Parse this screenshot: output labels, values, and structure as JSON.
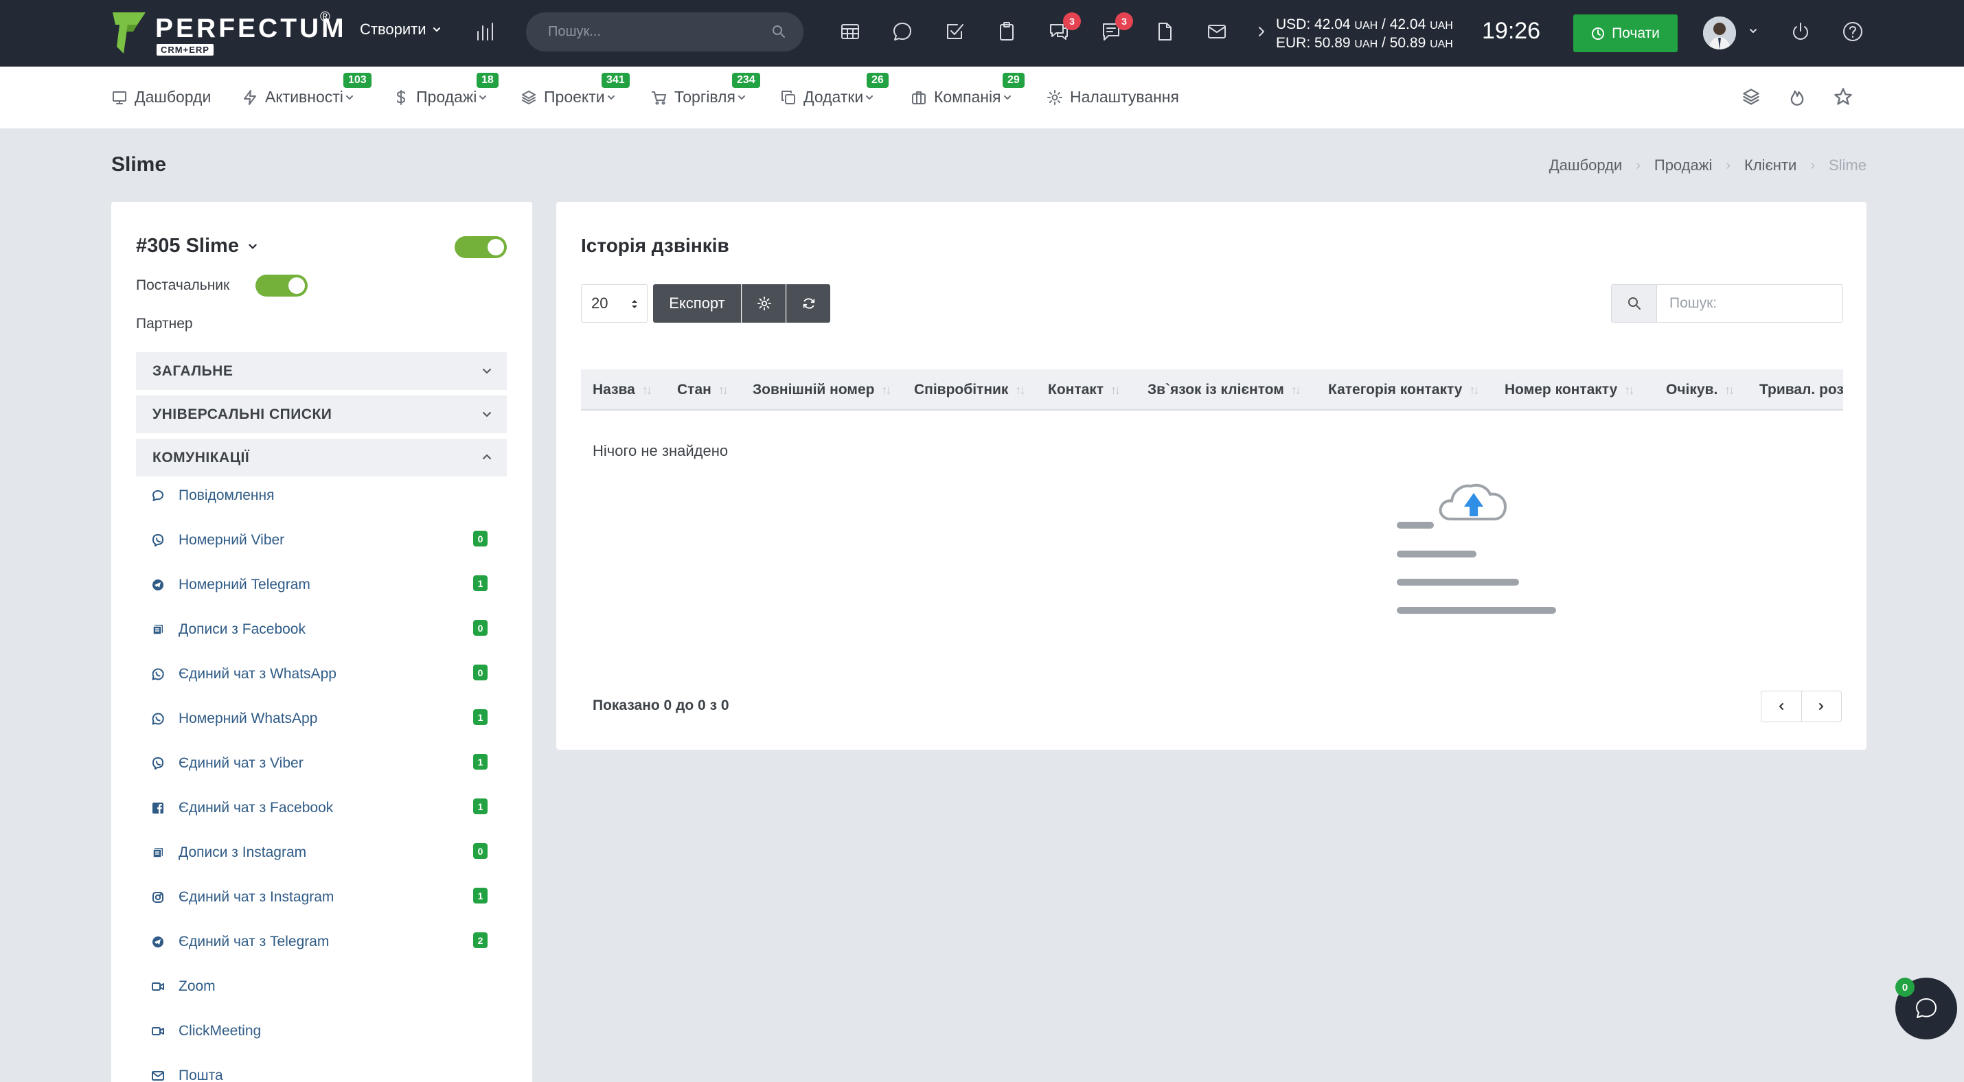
{
  "brand": {
    "name": "PERFECTUM",
    "sub": "CRM+ERP",
    "reg": "®"
  },
  "topbar": {
    "create_label": "Створити",
    "search_placeholder": "Пошук...",
    "icon_badges": {
      "chat_bubble": "3",
      "messages": "3"
    },
    "rates": {
      "usd": "USD: 42.04",
      "usd_rest": " / 42.04 ",
      "eur": "EUR: 50.89",
      "eur_rest": " / 50.89 ",
      "unit": "UAH"
    },
    "time": "19:26",
    "start_label": "Почати"
  },
  "menu": [
    {
      "label": "Дашборди",
      "icon": "monitor-icon",
      "badge": null
    },
    {
      "label": "Активності",
      "icon": "bolt-icon",
      "badge": "103"
    },
    {
      "label": "Продажі",
      "icon": "dollar-icon",
      "badge": "18"
    },
    {
      "label": "Проекти",
      "icon": "layers-icon",
      "badge": "341"
    },
    {
      "label": "Торгівля",
      "icon": "cart-icon",
      "badge": "234"
    },
    {
      "label": "Додатки",
      "icon": "copy-icon",
      "badge": "26"
    },
    {
      "label": "Компанія",
      "icon": "briefcase-icon",
      "badge": "29"
    },
    {
      "label": "Налаштування",
      "icon": "gear-icon",
      "badge": null
    }
  ],
  "page": {
    "title": "Slime",
    "breadcrumb": [
      "Дашборди",
      "Продажі",
      "Клієнти",
      "Slime"
    ]
  },
  "client": {
    "name": "#305 Slime",
    "supplier_label": "Постачальник",
    "partner_label": "Партнер",
    "sections": [
      "ЗАГАЛЬНЕ",
      "УНІВЕРСАЛЬНІ СПИСКИ",
      "КОМУНІКАЦІЇ"
    ],
    "communications": [
      {
        "label": "Повідомлення",
        "icon": "chat-icon",
        "count": null
      },
      {
        "label": "Номерний Viber",
        "icon": "viber-icon",
        "count": "0"
      },
      {
        "label": "Номерний Telegram",
        "icon": "telegram-icon",
        "count": "1"
      },
      {
        "label": "Дописи з Facebook",
        "icon": "posts-icon",
        "count": "0"
      },
      {
        "label": "Єдиний чат з WhatsApp",
        "icon": "whatsapp-icon",
        "count": "0"
      },
      {
        "label": "Номерний WhatsApp",
        "icon": "whatsapp-icon",
        "count": "1"
      },
      {
        "label": "Єдиний чат з Viber",
        "icon": "viber-icon",
        "count": "1"
      },
      {
        "label": "Єдиний чат з Facebook",
        "icon": "facebook-icon",
        "count": "1"
      },
      {
        "label": "Дописи з Instagram",
        "icon": "posts-icon",
        "count": "0"
      },
      {
        "label": "Єдиний чат з Instagram",
        "icon": "instagram-icon",
        "count": "1"
      },
      {
        "label": "Єдиний чат з Telegram",
        "icon": "telegram-icon",
        "count": "2"
      },
      {
        "label": "Zoom",
        "icon": "video-icon",
        "count": null
      },
      {
        "label": "ClickMeeting",
        "icon": "video-icon",
        "count": null
      },
      {
        "label": "Пошта",
        "icon": "mail-icon",
        "count": null
      }
    ]
  },
  "calls": {
    "title": "Історія дзвінків",
    "per_page": "20",
    "export_label": "Експорт",
    "search_placeholder": "Пошук:",
    "columns": [
      "Назва",
      "Стан",
      "Зовнішній номер",
      "Співробітник",
      "Контакт",
      "Зв`язок із клієнтом",
      "Категорія контакту",
      "Номер контакту",
      "Очікув.",
      "Тривал. розм"
    ],
    "empty_text": "Нічого не знайдено",
    "footer_info": "Показано 0 до 0 з 0"
  },
  "chat_widget": {
    "count": "0"
  },
  "colors": {
    "topbar": "#232a35",
    "accent_green": "#22a242",
    "badge_red": "#e54352",
    "toggle_green": "#74b13b",
    "link_blue": "#2f5b86"
  }
}
